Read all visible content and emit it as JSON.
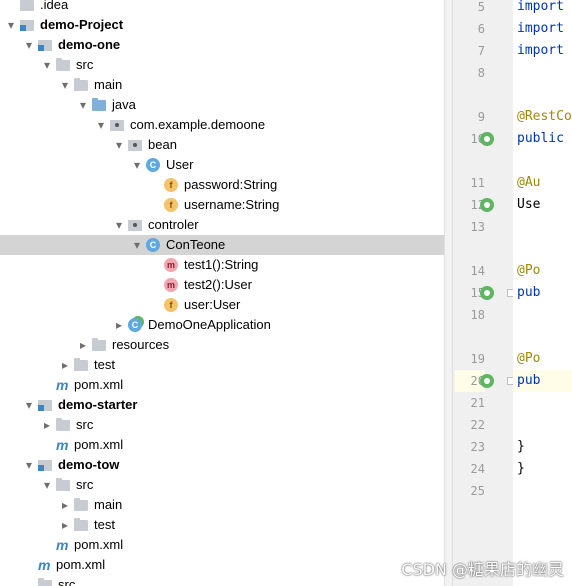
{
  "project_tree": {
    "rows": [
      {
        "label": ".idea",
        "indent": 0,
        "arrow": "",
        "icon": "folder-icon",
        "bold": false
      },
      {
        "label": "demo-Project",
        "indent": 0,
        "arrow": "▾",
        "icon": "module-icon",
        "bold": true
      },
      {
        "label": "demo-one",
        "indent": 1,
        "arrow": "▾",
        "icon": "module-icon",
        "bold": true
      },
      {
        "label": "src",
        "indent": 2,
        "arrow": "▾",
        "icon": "folder-icon",
        "bold": false
      },
      {
        "label": "main",
        "indent": 3,
        "arrow": "▾",
        "icon": "folder-icon",
        "bold": false
      },
      {
        "label": "java",
        "indent": 4,
        "arrow": "▾",
        "icon": "source-folder-icon",
        "bold": false
      },
      {
        "label": "com.example.demoone",
        "indent": 5,
        "arrow": "▾",
        "icon": "package-icon",
        "bold": false
      },
      {
        "label": "bean",
        "indent": 6,
        "arrow": "▾",
        "icon": "package-icon",
        "bold": false
      },
      {
        "label": "User",
        "indent": 7,
        "arrow": "▾",
        "icon": "class-icon",
        "bold": false
      },
      {
        "label": "password:String",
        "indent": 8,
        "arrow": "",
        "icon": "field-icon",
        "bold": false
      },
      {
        "label": "username:String",
        "indent": 8,
        "arrow": "",
        "icon": "field-icon",
        "bold": false
      },
      {
        "label": "controler",
        "indent": 6,
        "arrow": "▾",
        "icon": "package-icon",
        "bold": false
      },
      {
        "label": "ConTeone",
        "indent": 7,
        "arrow": "▾",
        "icon": "class-icon",
        "bold": false,
        "selected": true
      },
      {
        "label": "test1():String",
        "indent": 8,
        "arrow": "",
        "icon": "method-icon",
        "bold": false
      },
      {
        "label": "test2():User",
        "indent": 8,
        "arrow": "",
        "icon": "method-icon",
        "bold": false
      },
      {
        "label": "user:User",
        "indent": 8,
        "arrow": "",
        "icon": "field-icon",
        "bold": false
      },
      {
        "label": "DemoOneApplication",
        "indent": 6,
        "arrow": "▸",
        "icon": "spring-class-icon",
        "bold": false
      },
      {
        "label": "resources",
        "indent": 4,
        "arrow": "▸",
        "icon": "resources-folder-icon",
        "bold": false
      },
      {
        "label": "test",
        "indent": 3,
        "arrow": "▸",
        "icon": "folder-icon",
        "bold": false
      },
      {
        "label": "pom.xml",
        "indent": 2,
        "arrow": "",
        "icon": "maven-icon",
        "bold": false
      },
      {
        "label": "demo-starter",
        "indent": 1,
        "arrow": "▾",
        "icon": "module-icon",
        "bold": true
      },
      {
        "label": "src",
        "indent": 2,
        "arrow": "▸",
        "icon": "folder-icon",
        "bold": false
      },
      {
        "label": "pom.xml",
        "indent": 2,
        "arrow": "",
        "icon": "maven-icon",
        "bold": false
      },
      {
        "label": "demo-tow",
        "indent": 1,
        "arrow": "▾",
        "icon": "module-icon",
        "bold": true
      },
      {
        "label": "src",
        "indent": 2,
        "arrow": "▾",
        "icon": "folder-icon",
        "bold": false
      },
      {
        "label": "main",
        "indent": 3,
        "arrow": "▸",
        "icon": "folder-icon",
        "bold": false
      },
      {
        "label": "test",
        "indent": 3,
        "arrow": "▸",
        "icon": "folder-icon",
        "bold": false
      },
      {
        "label": "pom.xml",
        "indent": 2,
        "arrow": "",
        "icon": "maven-icon",
        "bold": false
      },
      {
        "label": "pom.xml",
        "indent": 1,
        "arrow": "",
        "icon": "maven-icon",
        "bold": false
      },
      {
        "label": "src",
        "indent": 1,
        "arrow": "",
        "icon": "folder-icon",
        "bold": false
      }
    ]
  },
  "editor": {
    "lines": [
      {
        "number": "5",
        "code": "import",
        "style": "kw",
        "gutter_icon": ""
      },
      {
        "number": "6",
        "code": "import",
        "style": "kw",
        "gutter_icon": ""
      },
      {
        "number": "7",
        "code": "import",
        "style": "kw",
        "gutter_icon": ""
      },
      {
        "number": "8",
        "code": "",
        "style": "",
        "gutter_icon": ""
      },
      {
        "number": "9",
        "code": "@RestCo",
        "style": "ann",
        "gutter_icon": ""
      },
      {
        "number": "10",
        "code": "public",
        "style": "kw",
        "gutter_icon": "spring-bean-icon"
      },
      {
        "number": "11",
        "code": "    @Au",
        "style": "ann",
        "gutter_icon": ""
      },
      {
        "number": "12",
        "code": "    Use",
        "style": "plain",
        "gutter_icon": "spring-bean-icon"
      },
      {
        "number": "13",
        "code": "",
        "style": "",
        "gutter_icon": ""
      },
      {
        "number": "14",
        "code": "    @Po",
        "style": "ann",
        "gutter_icon": ""
      },
      {
        "number": "15",
        "code": "    pub",
        "style": "kw",
        "gutter_icon": "spring-web-icon"
      },
      {
        "number": "18",
        "code": "",
        "style": "",
        "gutter_icon": ""
      },
      {
        "number": "19",
        "code": "    @Po",
        "style": "ann",
        "gutter_icon": ""
      },
      {
        "number": "20",
        "code": "    pub",
        "style": "kw",
        "gutter_icon": "spring-web-icon",
        "highlighted": true
      },
      {
        "number": "21",
        "code": "",
        "style": "",
        "gutter_icon": ""
      },
      {
        "number": "22",
        "code": "",
        "style": "",
        "gutter_icon": ""
      },
      {
        "number": "23",
        "code": "    }",
        "style": "plain",
        "gutter_icon": ""
      },
      {
        "number": "24",
        "code": "}",
        "style": "plain",
        "gutter_icon": ""
      },
      {
        "number": "25",
        "code": "",
        "style": "",
        "gutter_icon": ""
      }
    ]
  },
  "watermark": "CSDN @糖果店的幽灵"
}
